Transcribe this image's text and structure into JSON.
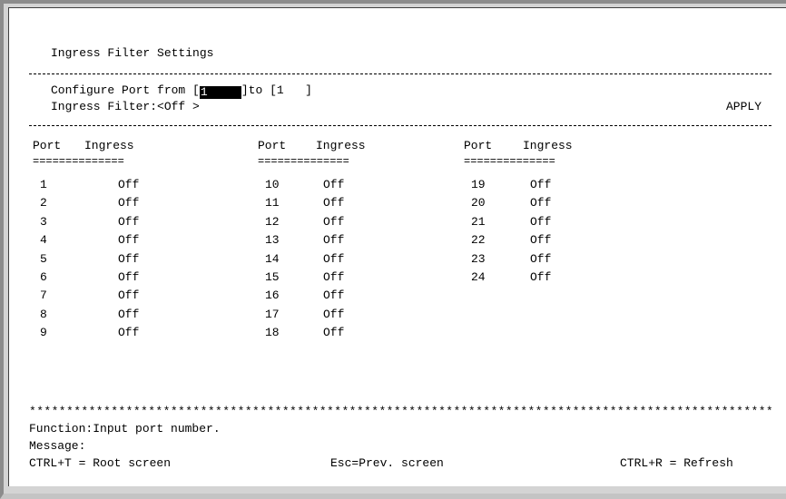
{
  "screen": {
    "title": "Ingress Filter Settings",
    "configure": {
      "label_from": "Configure Port from ",
      "from_value": "1",
      "label_to": "to ",
      "to_value": "1",
      "open_bracket": "[",
      "close_bracket": "]"
    },
    "ingress_filter": {
      "label": "Ingress Filter:",
      "value": "<Off >"
    },
    "apply_label": "APPLY",
    "table": {
      "headers": {
        "port": "Port",
        "ingress": "Ingress",
        "underline": "=============="
      },
      "columns": [
        [
          {
            "port": "1",
            "ingress": "Off"
          },
          {
            "port": "2",
            "ingress": "Off"
          },
          {
            "port": "3",
            "ingress": "Off"
          },
          {
            "port": "4",
            "ingress": "Off"
          },
          {
            "port": "5",
            "ingress": "Off"
          },
          {
            "port": "6",
            "ingress": "Off"
          },
          {
            "port": "7",
            "ingress": "Off"
          },
          {
            "port": "8",
            "ingress": "Off"
          },
          {
            "port": "9",
            "ingress": "Off"
          }
        ],
        [
          {
            "port": "10",
            "ingress": "Off"
          },
          {
            "port": "11",
            "ingress": "Off"
          },
          {
            "port": "12",
            "ingress": "Off"
          },
          {
            "port": "13",
            "ingress": "Off"
          },
          {
            "port": "14",
            "ingress": "Off"
          },
          {
            "port": "15",
            "ingress": "Off"
          },
          {
            "port": "16",
            "ingress": "Off"
          },
          {
            "port": "17",
            "ingress": "Off"
          },
          {
            "port": "18",
            "ingress": "Off"
          }
        ],
        [
          {
            "port": "19",
            "ingress": "Off"
          },
          {
            "port": "20",
            "ingress": "Off"
          },
          {
            "port": "21",
            "ingress": "Off"
          },
          {
            "port": "22",
            "ingress": "Off"
          },
          {
            "port": "23",
            "ingress": "Off"
          },
          {
            "port": "24",
            "ingress": "Off"
          }
        ]
      ]
    },
    "separator_stars": "****************************************************************************************************",
    "function_line": "Function:Input port number.",
    "message_line": "Message:",
    "footer": {
      "root": "CTRL+T = Root screen",
      "prev": "Esc=Prev. screen",
      "refresh": "CTRL+R = Refresh"
    }
  }
}
